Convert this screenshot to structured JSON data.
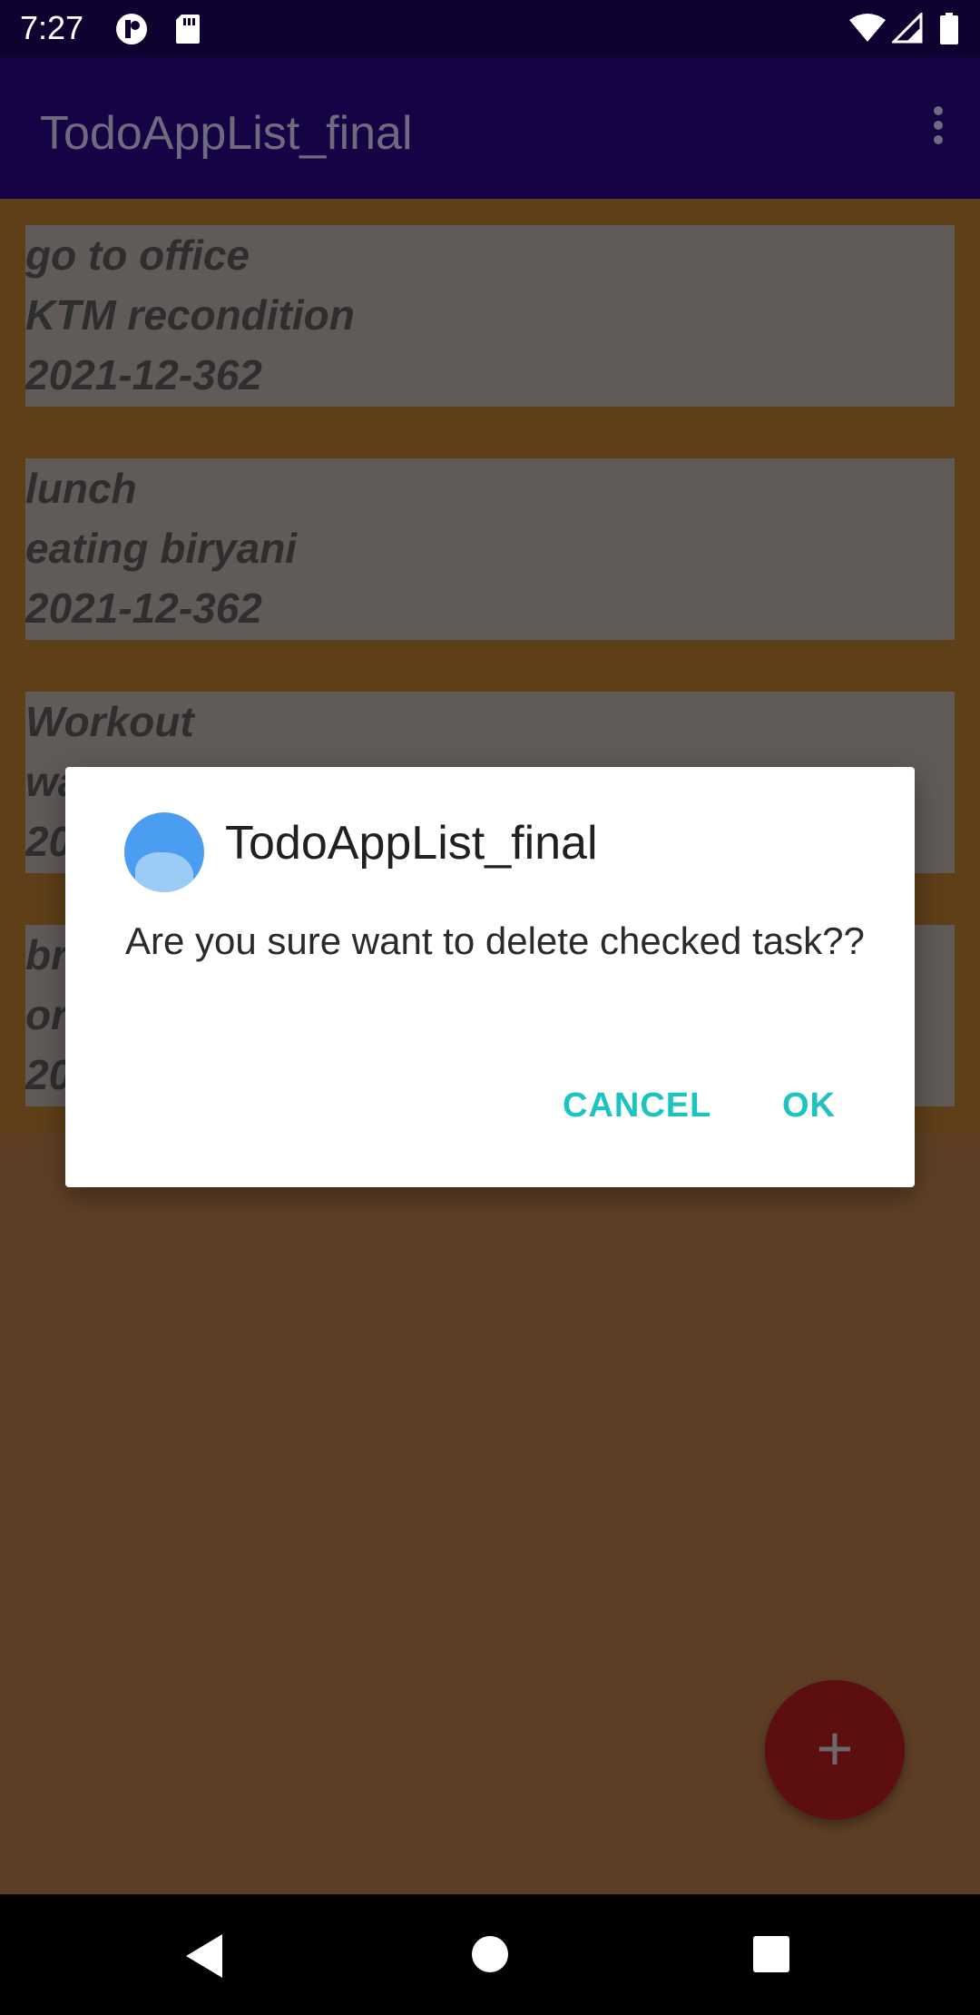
{
  "status_bar": {
    "time": "7:27",
    "icons": [
      "notification-app-icon",
      "sd-card-icon",
      "wifi-icon",
      "cellular-signal-icon",
      "battery-icon"
    ]
  },
  "app_bar": {
    "title": "TodoAppList_final",
    "overflow_icon": "more-vert-icon"
  },
  "tasks": [
    {
      "title": "go to office",
      "description": "KTM recondition",
      "date": "2021-12-362"
    },
    {
      "title": "lunch",
      "description": "eating biryani",
      "date": "2021-12-362"
    },
    {
      "title": "Workout",
      "description": "wa",
      "date": "20"
    },
    {
      "title": "br",
      "description": "or",
      "date": "20"
    }
  ],
  "dialog": {
    "title": "TodoAppList_final",
    "message": "Are you sure want to delete checked task??",
    "cancel_label": "CANCEL",
    "ok_label": "OK"
  },
  "fab": {
    "label": "+"
  },
  "nav_bar": {
    "icons": [
      "back-icon",
      "home-icon",
      "recents-icon"
    ]
  },
  "colors": {
    "status_bar": "#100230",
    "app_bar": "#150345",
    "dialog_button": "#1cc4c0",
    "fab": "#5c0e10"
  }
}
